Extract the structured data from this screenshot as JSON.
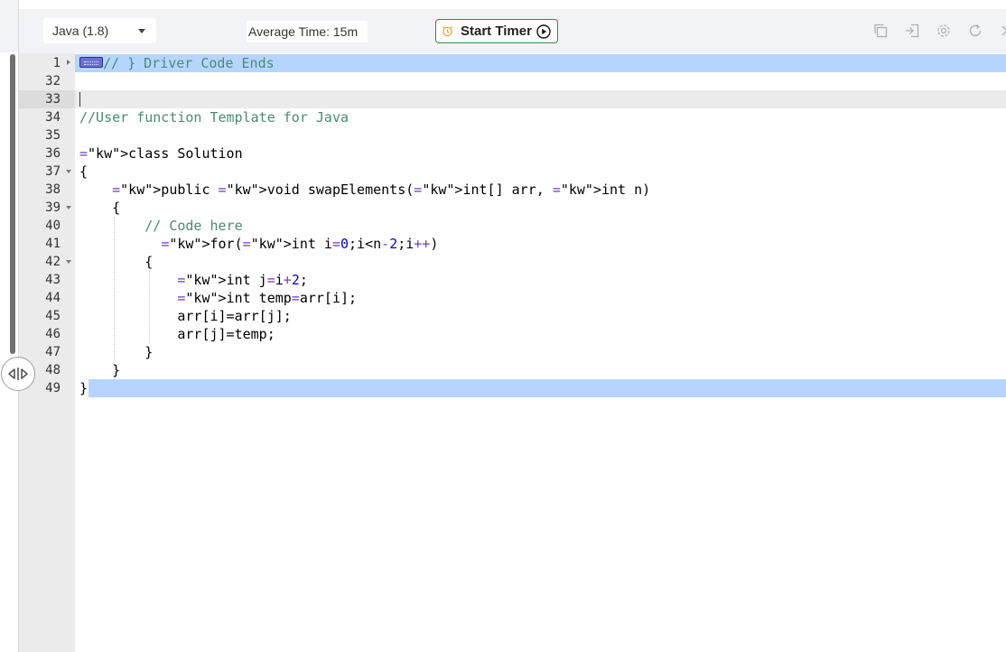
{
  "toolbar": {
    "language": "Java (1.8)",
    "average_time": "Average Time: 15m",
    "start_timer": "Start Timer",
    "icons": [
      "copy-icon",
      "exit-fullscreen-icon",
      "gear-icon",
      "reset-icon",
      "close-icon"
    ]
  },
  "colors": {
    "keyword": "#0000cc",
    "comment": "#4a8a76",
    "selection": "#b5d5ff",
    "timer_border": "#2f8d46"
  },
  "editor": {
    "lines": [
      {
        "num": "1",
        "fold": "right",
        "text": "// } Driver Code Ends"
      },
      {
        "num": "32",
        "fold": "",
        "text": ""
      },
      {
        "num": "33",
        "fold": "",
        "text": ""
      },
      {
        "num": "34",
        "fold": "",
        "text": "//User function Template for Java"
      },
      {
        "num": "35",
        "fold": "",
        "text": ""
      },
      {
        "num": "36",
        "fold": "",
        "text": "class Solution"
      },
      {
        "num": "37",
        "fold": "down",
        "text": "{"
      },
      {
        "num": "38",
        "fold": "",
        "text": "    public void swapElements(int[] arr, int n)"
      },
      {
        "num": "39",
        "fold": "down",
        "text": "    {"
      },
      {
        "num": "40",
        "fold": "",
        "text": "        // Code here"
      },
      {
        "num": "41",
        "fold": "",
        "text": "          for(int i=0;i<n-2;i++)"
      },
      {
        "num": "42",
        "fold": "down",
        "text": "        {"
      },
      {
        "num": "43",
        "fold": "",
        "text": "            int j=i+2;"
      },
      {
        "num": "44",
        "fold": "",
        "text": "            int temp=arr[i];"
      },
      {
        "num": "45",
        "fold": "",
        "text": "            arr[i]=arr[j];"
      },
      {
        "num": "46",
        "fold": "",
        "text": "            arr[j]=temp;"
      },
      {
        "num": "47",
        "fold": "",
        "text": "        }"
      },
      {
        "num": "48",
        "fold": "",
        "text": "    }"
      },
      {
        "num": "49",
        "fold": "",
        "text": "}"
      }
    ]
  }
}
